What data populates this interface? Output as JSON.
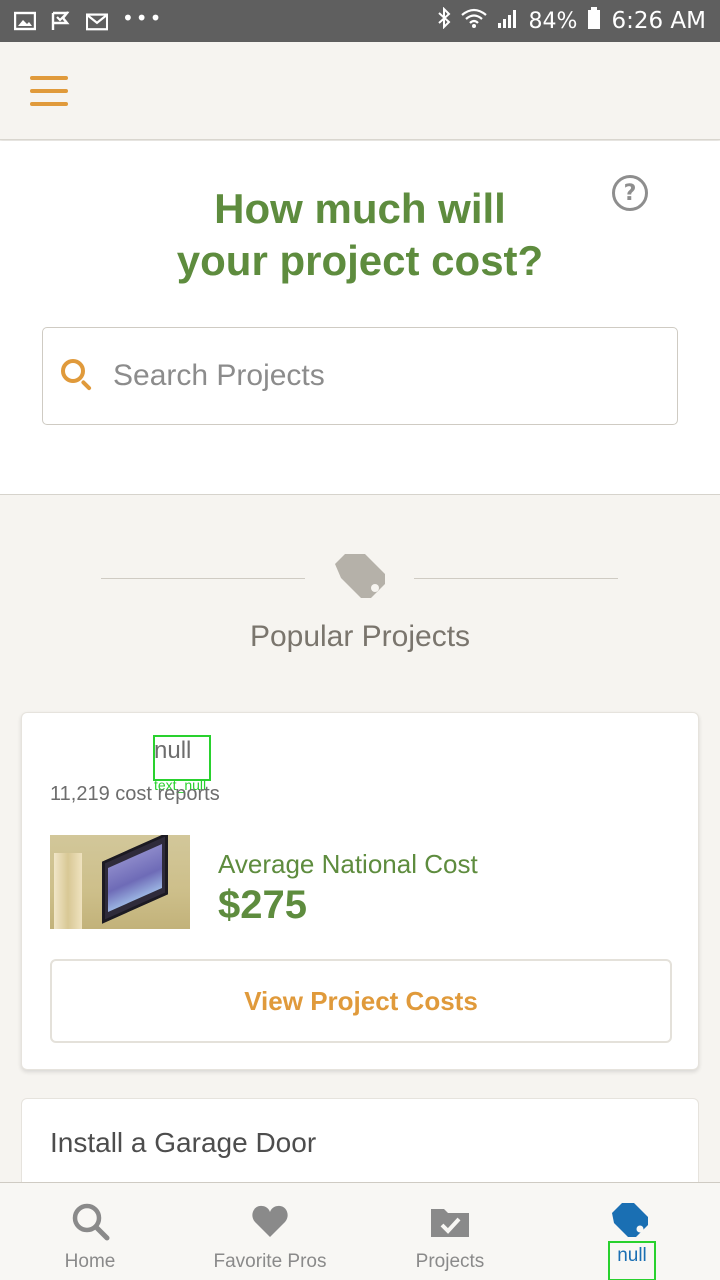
{
  "status_bar": {
    "battery": "84%",
    "time": "6:26 AM",
    "dots": "•••"
  },
  "hero": {
    "title_line1": "How much will",
    "title_line2": "your project cost?",
    "search_placeholder": "Search Projects",
    "help_glyph": "?"
  },
  "popular": {
    "heading": "Popular Projects"
  },
  "card": {
    "name": "null",
    "name_tag": "text_null",
    "reports": "11,219 cost reports",
    "avg_label": "Average National Cost",
    "avg_value": "$275",
    "button": "View Project Costs"
  },
  "card2": {
    "title": "Install a Garage Door"
  },
  "bottom_nav": {
    "items": [
      {
        "label": "Home",
        "icon": "search-icon"
      },
      {
        "label": "Favorite Pros",
        "icon": "heart-icon"
      },
      {
        "label": "Projects",
        "icon": "folder-check-icon"
      },
      {
        "label": "null",
        "icon": "tag-icon"
      }
    ]
  },
  "colors": {
    "brand_green": "#5e8c3e",
    "accent_orange": "#e09a3b",
    "active_blue": "#1a6fb3"
  }
}
